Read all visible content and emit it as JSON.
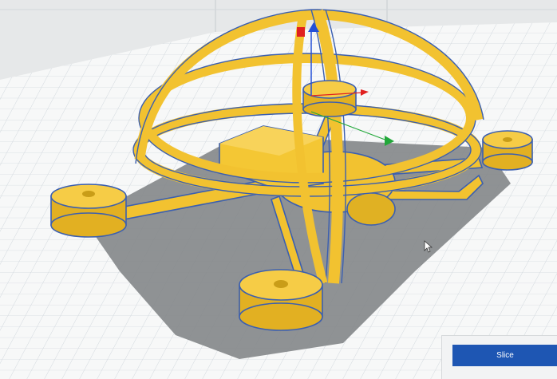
{
  "app": {
    "view": "3d-build-plate",
    "colors": {
      "background": "#e9ebec",
      "plate": "#ffffff",
      "grid": "#cfd6dc",
      "model": "#f2c230",
      "model_shade": "#caa01a",
      "model_outline": "#3b5fb0",
      "shadow": "#7f8284",
      "axis_x": "#e02020",
      "axis_y": "#22a83a",
      "axis_z": "#2450d8",
      "slice_button": "#1e56b3"
    }
  },
  "slice_panel": {
    "slice_label": "Slice"
  }
}
